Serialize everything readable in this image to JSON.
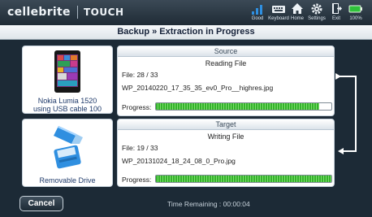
{
  "header": {
    "brand": "cellebrite",
    "product": "TOUCH",
    "toolbar": [
      {
        "name": "Good",
        "icon": "signal-bars-icon"
      },
      {
        "name": "Keyboard",
        "icon": "keyboard-icon"
      },
      {
        "name": "Home",
        "icon": "home-icon"
      },
      {
        "name": "Settings",
        "icon": "gear-icon"
      },
      {
        "name": "Exit",
        "icon": "exit-door-icon"
      },
      {
        "name": "100%",
        "icon": "battery-icon"
      }
    ]
  },
  "title": "Backup » Extraction in Progress",
  "source_device": {
    "caption_line1": "Nokia Lumia 1520",
    "caption_line2": "using USB cable 100"
  },
  "target_device": {
    "caption": "Removable Drive"
  },
  "source": {
    "header": "Source",
    "status": "Reading File",
    "file_label": "File:",
    "file_count": "28 / 33",
    "file_name": "WP_20140220_17_35_35_ev0_Pro__highres.jpg",
    "progress_label": "Progress:",
    "progress": 0.93
  },
  "target": {
    "header": "Target",
    "status": "Writing File",
    "file_label": "File:",
    "file_count": "19 / 33",
    "file_name": "WP_20131024_18_24_08_0_Pro.jpg",
    "progress_label": "Progress:",
    "progress": 1.0
  },
  "footer": {
    "cancel_label": "Cancel",
    "time_remaining": "Time Remaining : 00:00:04"
  },
  "colors": {
    "progress_green": "#33b32b",
    "background": "#1c2a36",
    "title_text": "#17233a"
  }
}
